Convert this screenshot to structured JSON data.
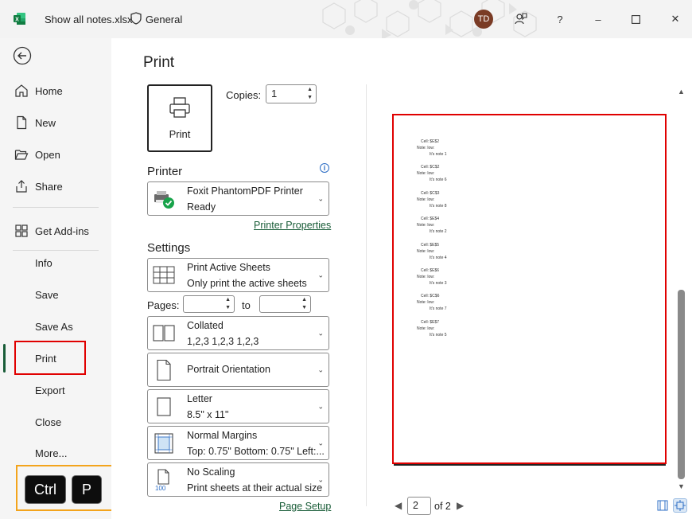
{
  "window": {
    "file_name": "Show all notes.xlsx",
    "sensitivity": "General",
    "user_initials": "TD",
    "help_label": "?",
    "minimize_label": "–",
    "close_label": "✕"
  },
  "nav": {
    "items": [
      {
        "label": "Home"
      },
      {
        "label": "New"
      },
      {
        "label": "Open"
      },
      {
        "label": "Share"
      },
      {
        "label": "Get Add-ins"
      },
      {
        "label": "Info"
      },
      {
        "label": "Save"
      },
      {
        "label": "Save As"
      },
      {
        "label": "Print"
      },
      {
        "label": "Export"
      },
      {
        "label": "Close"
      },
      {
        "label": "More..."
      }
    ],
    "selected": "Print"
  },
  "shortcut": {
    "keys": [
      "Ctrl",
      "P"
    ]
  },
  "print": {
    "heading": "Print",
    "button_label": "Print",
    "copies_label": "Copies:",
    "copies_value": "1",
    "printer_title": "Printer",
    "printer_name": "Foxit PhantomPDF Printer",
    "printer_status": "Ready",
    "printer_properties": "Printer Properties",
    "settings_title": "Settings",
    "settings": [
      {
        "line1": "Print Active Sheets",
        "line2": "Only print the active sheets"
      },
      {
        "line1": "Collated",
        "line2": "1,2,3    1,2,3    1,2,3"
      },
      {
        "line1": "Portrait Orientation",
        "line2": ""
      },
      {
        "line1": "Letter",
        "line2": "8.5\" x 11\""
      },
      {
        "line1": "Normal Margins",
        "line2": "Top: 0.75\" Bottom: 0.75\" Left:..."
      },
      {
        "line1": "No Scaling",
        "line2": "Print sheets at their actual size"
      }
    ],
    "scaling_badge": "100",
    "pages_label": "Pages:",
    "to_label": "to",
    "pages_from": "",
    "pages_to": "",
    "page_setup": "Page Setup"
  },
  "preview": {
    "notes": [
      {
        "cell": "Cell: $E$2",
        "note": "Note: low:",
        "text": "It's note 1"
      },
      {
        "cell": "Cell: $C$2",
        "note": "Note: low:",
        "text": "It's note 6"
      },
      {
        "cell": "Cell: $C$3",
        "note": "Note: low:",
        "text": "It's note 8"
      },
      {
        "cell": "Cell: $E$4",
        "note": "Note: low:",
        "text": "It's note 2"
      },
      {
        "cell": "Cell: $E$5",
        "note": "Note: low:",
        "text": "It's note 4"
      },
      {
        "cell": "Cell: $E$6",
        "note": "Note: low:",
        "text": "It's note 3"
      },
      {
        "cell": "Cell: $C$6",
        "note": "Note: low:",
        "text": "It's note 7"
      },
      {
        "cell": "Cell: $E$7",
        "note": "Note: low:",
        "text": "It's note 5"
      }
    ],
    "current_page": "2",
    "of_pages": "of 2"
  },
  "colors": {
    "accent": "#185c37",
    "highlight_red": "#e00000",
    "highlight_orange": "#f3a41c"
  }
}
